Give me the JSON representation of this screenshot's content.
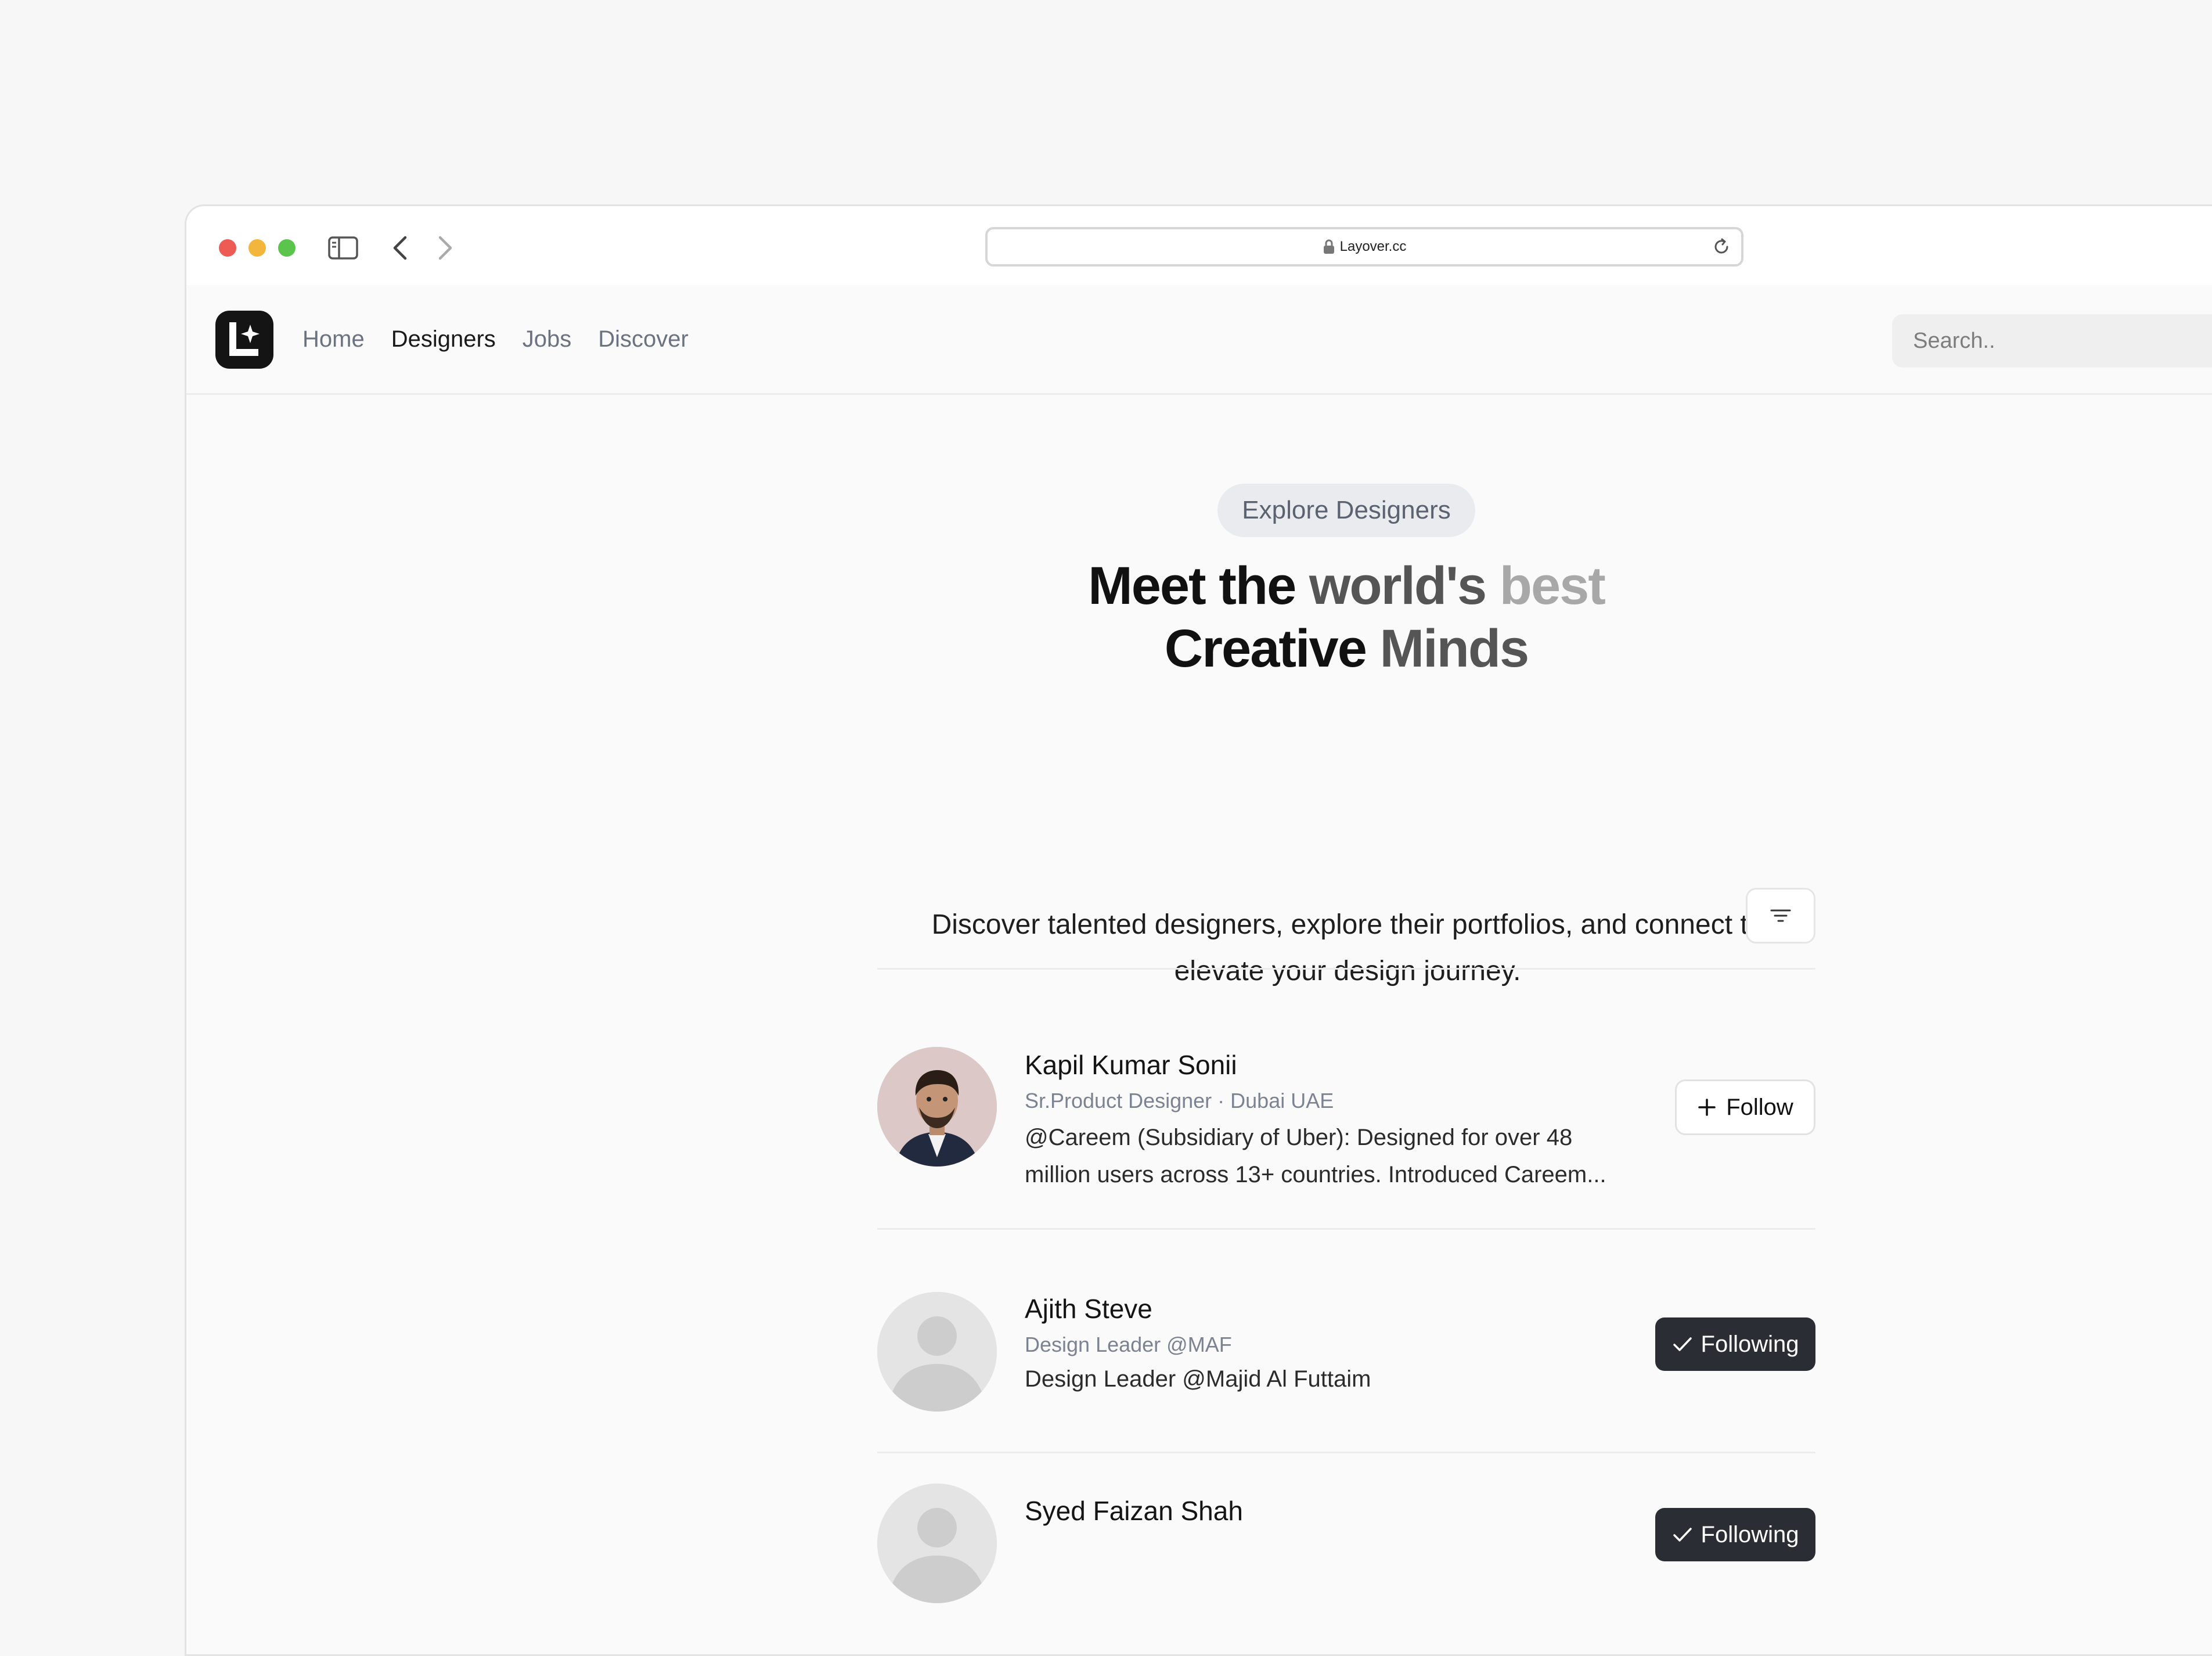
{
  "browser": {
    "url": "Layover.cc"
  },
  "header": {
    "nav": [
      {
        "label": "Home",
        "active": false
      },
      {
        "label": "Designers",
        "active": true
      },
      {
        "label": "Jobs",
        "active": false
      },
      {
        "label": "Discover",
        "active": false
      }
    ],
    "search_placeholder": "Search.."
  },
  "hero": {
    "pill": "Explore Designers",
    "headline_line1_a": "Meet the",
    "headline_line1_b": "world's",
    "headline_line1_c": "best",
    "headline_line2_a": "Creative",
    "headline_line2_b": "Minds",
    "subtitle": "Discover talented designers, explore their portfolios, and connect to elevate your design journey."
  },
  "designers": [
    {
      "name": "Kapil Kumar Sonii",
      "meta": "Sr.Product Designer · Dubai UAE",
      "bio": "@Careem (Subsidiary of Uber): Designed for over 48 million users across 13+ countries. Introduced Careem...",
      "action": "Follow"
    },
    {
      "name": "Ajith Steve",
      "meta": "Design Leader @MAF",
      "bio": "Design Leader @Majid Al Futtaim",
      "action": "Following"
    },
    {
      "name": "Syed Faizan Shah",
      "meta": "",
      "bio": "",
      "action": "Following"
    }
  ],
  "colors": {
    "following_bg": "#2a2d33",
    "page_bg": "#fafafa",
    "pill_bg": "#e9ebee"
  }
}
